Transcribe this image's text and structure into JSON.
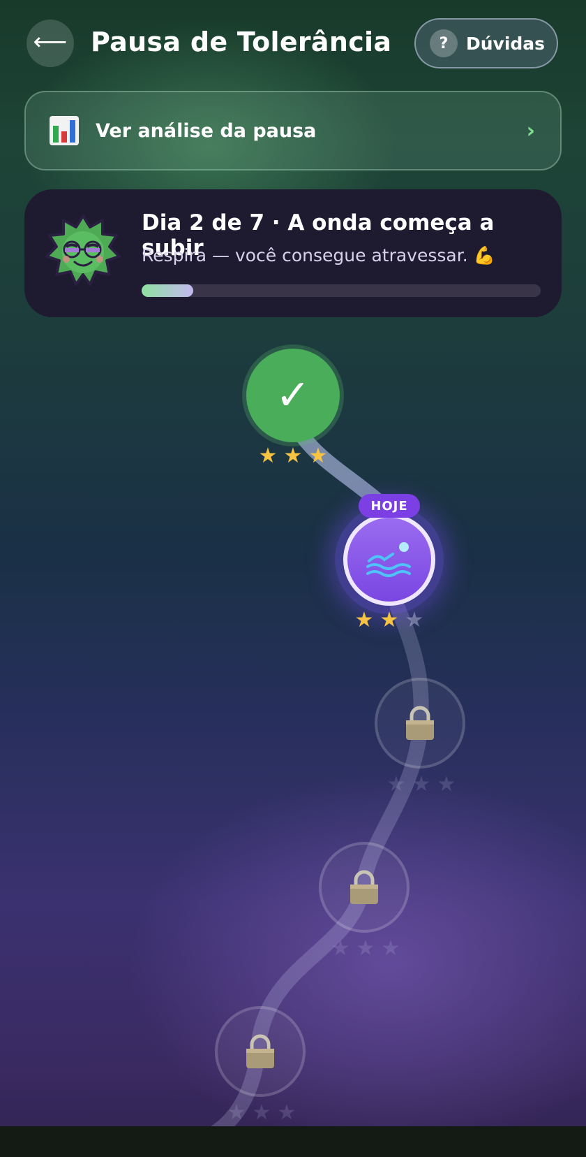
{
  "header": {
    "title": "Pausa de Tolerância",
    "back_icon": "arrow-left-icon",
    "help_icon_text": "?",
    "help_label": "Dúvidas"
  },
  "analysis": {
    "icon": "bar-chart-icon",
    "label": "Ver análise da pausa",
    "chevron": "›"
  },
  "progress": {
    "title": "Dia 2 de 7 · A onda começa a subir",
    "subtitle": "Respira — você consegue atravessar. 💪",
    "fraction": 0.13,
    "mascot_icon": "smiling-leaf-mascot-icon"
  },
  "path": {
    "today_badge": "HOJE",
    "nodes": [
      {
        "state": "done",
        "glyph": "✓",
        "stars_earned": 3
      },
      {
        "state": "today",
        "icon": "swimming-wave-icon",
        "stars_earned": 2
      },
      {
        "state": "locked",
        "icon": "lock-icon",
        "stars_earned": 0
      },
      {
        "state": "locked",
        "icon": "lock-icon",
        "stars_earned": 0
      },
      {
        "state": "locked",
        "icon": "lock-icon",
        "stars_earned": 0
      }
    ],
    "star_glyph": "★"
  },
  "colors": {
    "done": "#49ad5a",
    "today": "#8a58ea",
    "star": "#f6c343",
    "accent_green": "#7fe08e"
  }
}
